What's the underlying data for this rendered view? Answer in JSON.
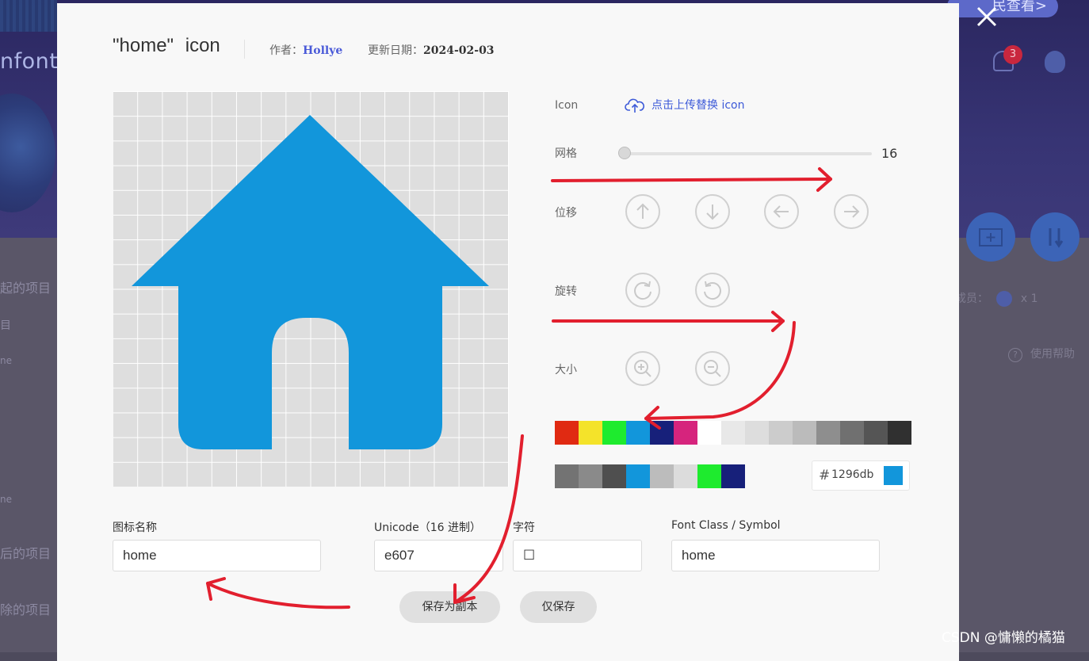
{
  "background": {
    "logo_text": "nfont",
    "banner_button": "民查看>",
    "notification_count": "3",
    "sidebar_items": [
      "起的项目",
      "目",
      "ne",
      "ne",
      "后的项目",
      "除的项目"
    ],
    "members_label": "成员：",
    "members_count": "x 1",
    "help_label": "使用帮助",
    "help_icon_char": "?"
  },
  "modal": {
    "title": {
      "name": "\"home\"",
      "suffix": "icon"
    },
    "author_label": "作者：",
    "author": "Hollye",
    "date_label": "更新日期：",
    "date": "2024-02-03",
    "close_symbol": "✕",
    "controls": {
      "icon_label": "Icon",
      "upload_text": "点击上传替换 icon",
      "grid_label": "网格",
      "grid_value": "16",
      "move_label": "位移",
      "rotate_label": "旋转",
      "size_label": "大小"
    },
    "palette_row1": [
      "#e02a12",
      "#f4e32a",
      "#1eeb2e",
      "#1296db",
      "#17207a",
      "#d6247d",
      "#ffffff",
      "#e8e8e8",
      "#dddddd",
      "#cccccc",
      "#bbbbbb",
      "#8e8e8e",
      "#707070",
      "#555555",
      "#303030"
    ],
    "palette_row2": [
      "#737373",
      "#8a8a8a",
      "#4f4f4f",
      "#1296db",
      "#bcbcbc",
      "#dcdcdc",
      "#1eeb2e",
      "#17207a"
    ],
    "hex": {
      "hash": "#",
      "value": "1296db",
      "color": "#1296db"
    },
    "fields": {
      "name_label": "图标名称",
      "name_value": "home",
      "unicode_label": "Unicode（16 进制）",
      "unicode_value": "e607",
      "char_label": "字符",
      "char_value": "☐",
      "class_label": "Font Class / Symbol",
      "class_value": "home"
    },
    "buttons": {
      "save_copy": "保存为副本",
      "save_only": "仅保存"
    }
  },
  "icon_color": "#1296db",
  "annotation_color": "#e21f2e",
  "watermark": "CSDN @慵懒的橘猫"
}
